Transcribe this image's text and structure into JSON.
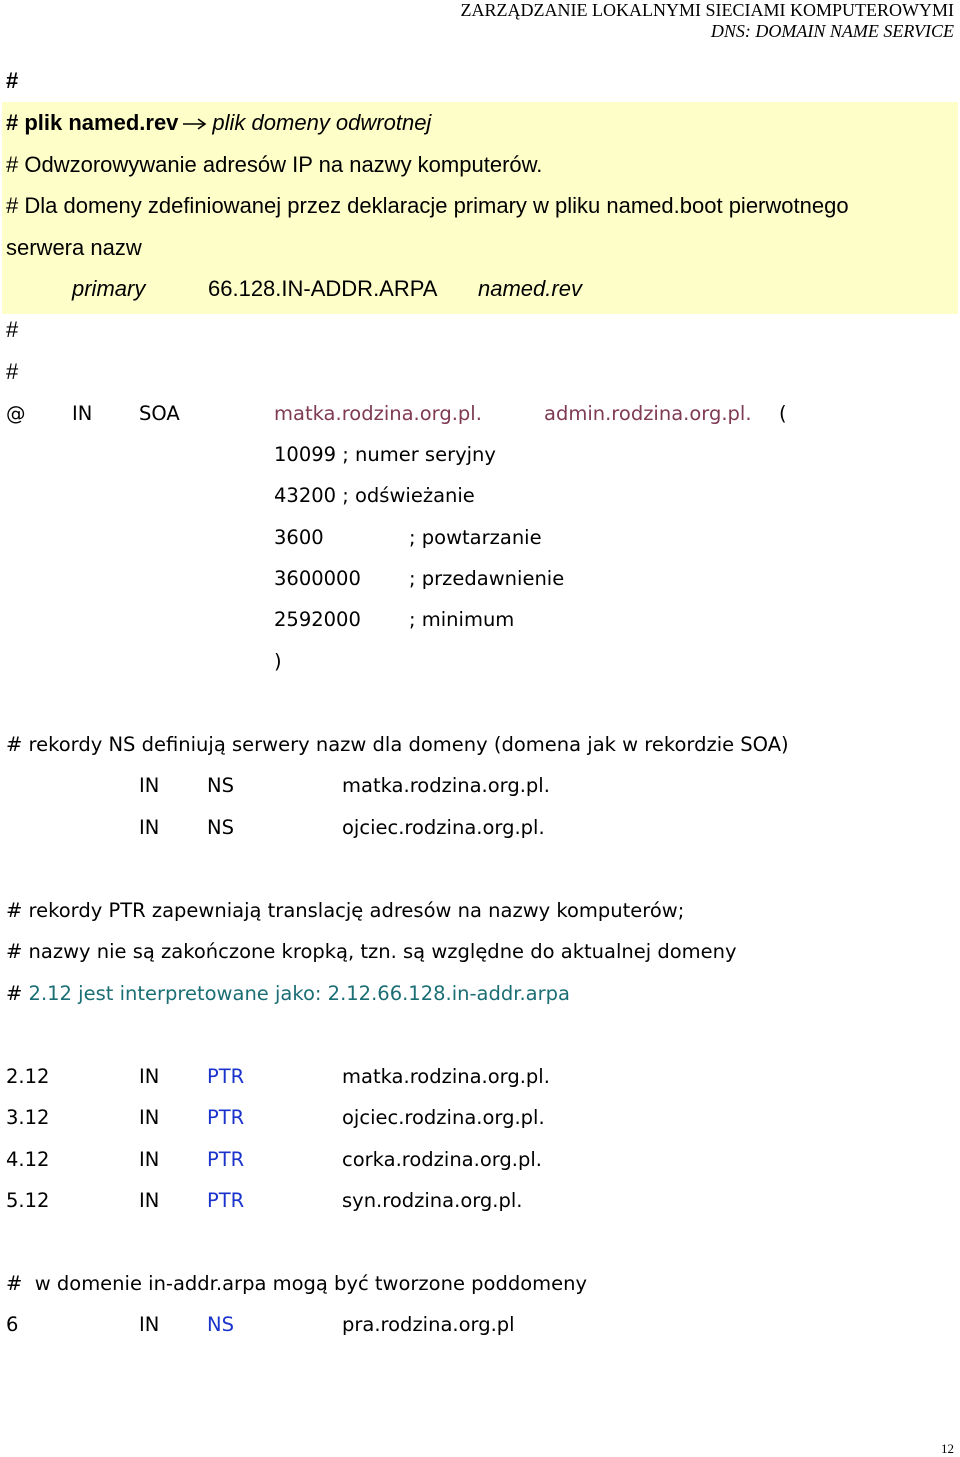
{
  "colors": {
    "highlight": "#fefec9",
    "maroon": "#7f3a54",
    "teal": "#1a6e74",
    "blue": "#1a33cc"
  },
  "header": {
    "line1": "ZARZĄDZANIE LOKALNYMI SIECIAMI KOMPUTEROWYMI",
    "line2": "DNS: DOMAIN NAME SERVICE"
  },
  "intro": {
    "hash_top": "#",
    "title_bold": "# plik named.rev",
    "arrow_icon": "right-arrow-icon",
    "title_italic": "plik domeny odwrotnej",
    "line1": "# Odwzorowywanie adresów IP na nazwy komputerów.",
    "line2a": "# Dla domeny zdefiniowanej przez deklaracje primary w pliku named.boot pierwotnego",
    "line2b": "serwera nazw",
    "primary": "primary",
    "zone": "66.128.IN-ADDR.ARPA",
    "file": "named.rev",
    "hash1": "#",
    "hash2": "#"
  },
  "soa": {
    "at": "@",
    "in": "IN",
    "type": "SOA",
    "ns": "matka.rodzina.org.pl.",
    "admin": "admin.rodzina.org.pl.",
    "open": "(",
    "serial": "10099 ; numer seryjny",
    "refresh": "43200 ; odświeżanie",
    "retry_val": "3600",
    "retry_cmt": "; powtarzanie",
    "expire_val": "3600000",
    "expire_cmt": "; przedawnienie",
    "min_val": "2592000",
    "min_cmt": "; minimum",
    "close": ")"
  },
  "ns_section": {
    "comment": "# rekordy NS definiują serwery nazw dla domeny (domena jak w rekordzie SOA)",
    "records": [
      {
        "class": "IN",
        "type": "NS",
        "host": "matka.rodzina.org.pl."
      },
      {
        "class": "IN",
        "type": "NS",
        "host": "ojciec.rodzina.org.pl."
      }
    ]
  },
  "ptr_section": {
    "comment1": "# rekordy PTR zapewniają translację adresów na nazwy komputerów;",
    "comment2": "# nazwy nie są zakończone kropką, tzn. są względne do aktualnej domeny",
    "comment3_hash": "#",
    "comment3_rest": " 2.12 jest interpretowane jako: 2.12.66.128.in-addr.arpa",
    "records": [
      {
        "name": "2.12",
        "class": "IN",
        "type": "PTR",
        "host": "matka.rodzina.org.pl."
      },
      {
        "name": "3.12",
        "class": "IN",
        "type": "PTR",
        "host": "ojciec.rodzina.org.pl."
      },
      {
        "name": "4.12",
        "class": "IN",
        "type": "PTR",
        "host": "corka.rodzina.org.pl."
      },
      {
        "name": "5.12",
        "class": "IN",
        "type": "PTR",
        "host": "syn.rodzina.org.pl."
      }
    ]
  },
  "sub_section": {
    "comment": "#  w domenie in-addr.arpa mogą być tworzone poddomeny",
    "record": {
      "name": "6",
      "class": "IN",
      "type": "NS",
      "host": "pra.rodzina.org.pl"
    }
  },
  "page_number": "12"
}
